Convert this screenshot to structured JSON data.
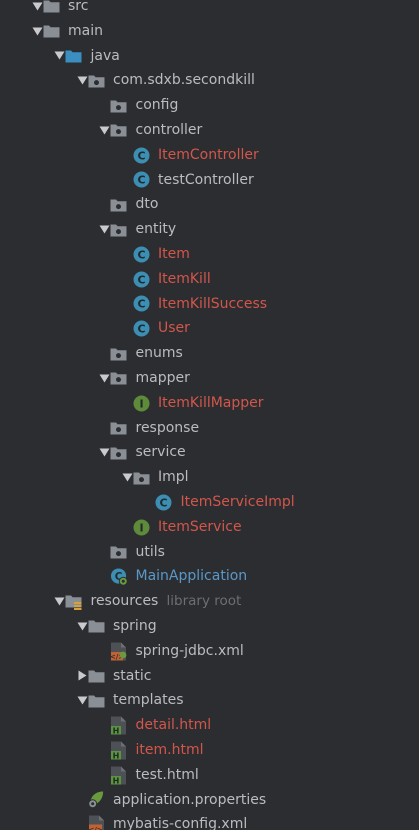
{
  "colors": {
    "background": "#2b2d30",
    "text_default": "#bbbcbf",
    "text_modified": "#d3564b",
    "text_added": "#5a98c9",
    "text_hint": "#6b6e73",
    "folder": "#8a8f96",
    "class_icon": "#3d8eb3",
    "interface_icon": "#5e8a3a"
  },
  "tree": [
    {
      "label": "src",
      "icon": "folder-icon",
      "expanded": true,
      "color": "default"
    },
    {
      "label": "main",
      "icon": "folder-icon",
      "expanded": true,
      "color": "default"
    },
    {
      "label": "java",
      "icon": "source-folder-icon",
      "expanded": true,
      "color": "default"
    },
    {
      "label": "com.sdxb.secondkill",
      "icon": "package-icon",
      "expanded": true,
      "color": "default"
    },
    {
      "label": "config",
      "icon": "package-icon",
      "color": "default"
    },
    {
      "label": "controller",
      "icon": "package-icon",
      "expanded": true,
      "color": "default"
    },
    {
      "label": "ItemController",
      "icon": "class-icon",
      "color": "red"
    },
    {
      "label": "testController",
      "icon": "class-icon",
      "color": "default"
    },
    {
      "label": "dto",
      "icon": "package-icon",
      "color": "default"
    },
    {
      "label": "entity",
      "icon": "package-icon",
      "expanded": true,
      "color": "default"
    },
    {
      "label": "Item",
      "icon": "class-icon",
      "color": "red"
    },
    {
      "label": "ItemKill",
      "icon": "class-icon",
      "color": "red"
    },
    {
      "label": "ItemKillSuccess",
      "icon": "class-icon",
      "color": "red"
    },
    {
      "label": "User",
      "icon": "class-icon",
      "color": "red"
    },
    {
      "label": "enums",
      "icon": "package-icon",
      "color": "default"
    },
    {
      "label": "mapper",
      "icon": "package-icon",
      "expanded": true,
      "color": "default"
    },
    {
      "label": "ItemKillMapper",
      "icon": "interface-icon",
      "color": "red"
    },
    {
      "label": "response",
      "icon": "package-icon",
      "color": "default"
    },
    {
      "label": "service",
      "icon": "package-icon",
      "expanded": true,
      "color": "default"
    },
    {
      "label": "Impl",
      "icon": "package-icon",
      "expanded": true,
      "color": "default"
    },
    {
      "label": "ItemServiceImpl",
      "icon": "class-icon",
      "color": "red"
    },
    {
      "label": "ItemService",
      "icon": "interface-icon",
      "color": "red"
    },
    {
      "label": "utils",
      "icon": "package-icon",
      "color": "default"
    },
    {
      "label": "MainApplication",
      "icon": "spring-boot-class-icon",
      "color": "blue"
    },
    {
      "label": "resources",
      "icon": "resources-folder-icon",
      "expanded": true,
      "color": "default",
      "suffix": "library root"
    },
    {
      "label": "spring",
      "icon": "folder-icon",
      "expanded": true,
      "color": "default"
    },
    {
      "label": "spring-jdbc.xml",
      "icon": "spring-xml-icon",
      "color": "default"
    },
    {
      "label": "static",
      "icon": "folder-icon",
      "expanded": false,
      "color": "default"
    },
    {
      "label": "templates",
      "icon": "folder-icon",
      "expanded": true,
      "color": "default"
    },
    {
      "label": "detail.html",
      "icon": "html-icon",
      "color": "red"
    },
    {
      "label": "item.html",
      "icon": "html-icon",
      "color": "red"
    },
    {
      "label": "test.html",
      "icon": "html-icon",
      "color": "default"
    },
    {
      "label": "application.properties",
      "icon": "properties-icon",
      "color": "default"
    },
    {
      "label": "mybatis-config.xml",
      "icon": "xml-icon",
      "color": "default"
    }
  ]
}
